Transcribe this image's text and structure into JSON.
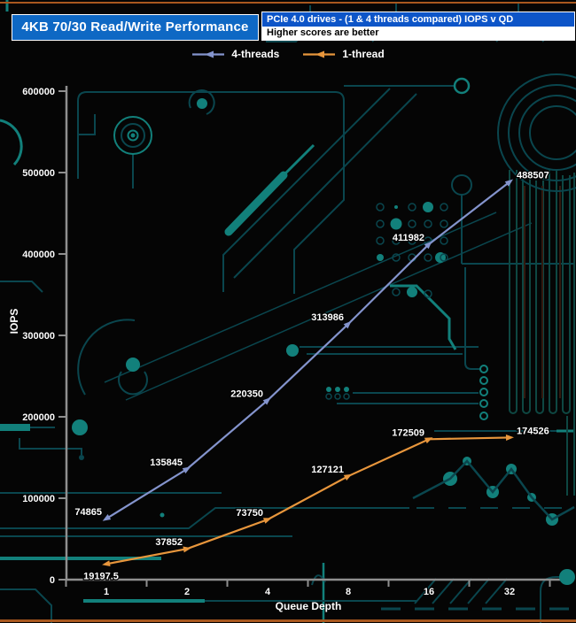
{
  "page": {
    "background": "#050505",
    "edge_accent": "#a8571e"
  },
  "header": {
    "title": "4KB 70/30 Read/Write Performance",
    "title_bg": "#0e68c4",
    "subtitle_primary": "PCIe 4.0 drives - (1 & 4 threads compared) IOPS v QD",
    "subtitle_primary_bg": "#0d55c8",
    "subtitle_secondary": "Higher scores are better"
  },
  "chart_data": {
    "type": "line",
    "x": [
      1,
      2,
      4,
      8,
      16,
      32
    ],
    "x_scale": "log2",
    "xlabel": "Queue Depth",
    "ylabel": "IOPS",
    "ylim": [
      0,
      600000
    ],
    "yticks": [
      0,
      100000,
      200000,
      300000,
      400000,
      500000,
      600000
    ],
    "grid": false,
    "legend_position": "top",
    "axis_color": "#8f8f8f",
    "series": [
      {
        "name": "4-threads",
        "color": "#8494cd",
        "values": [
          74865,
          135845,
          220350,
          313986,
          411982,
          488507
        ]
      },
      {
        "name": "1-thread",
        "color": "#e8963c",
        "values": [
          19197.5,
          37852,
          73750,
          127121,
          172509,
          174526
        ]
      }
    ]
  }
}
